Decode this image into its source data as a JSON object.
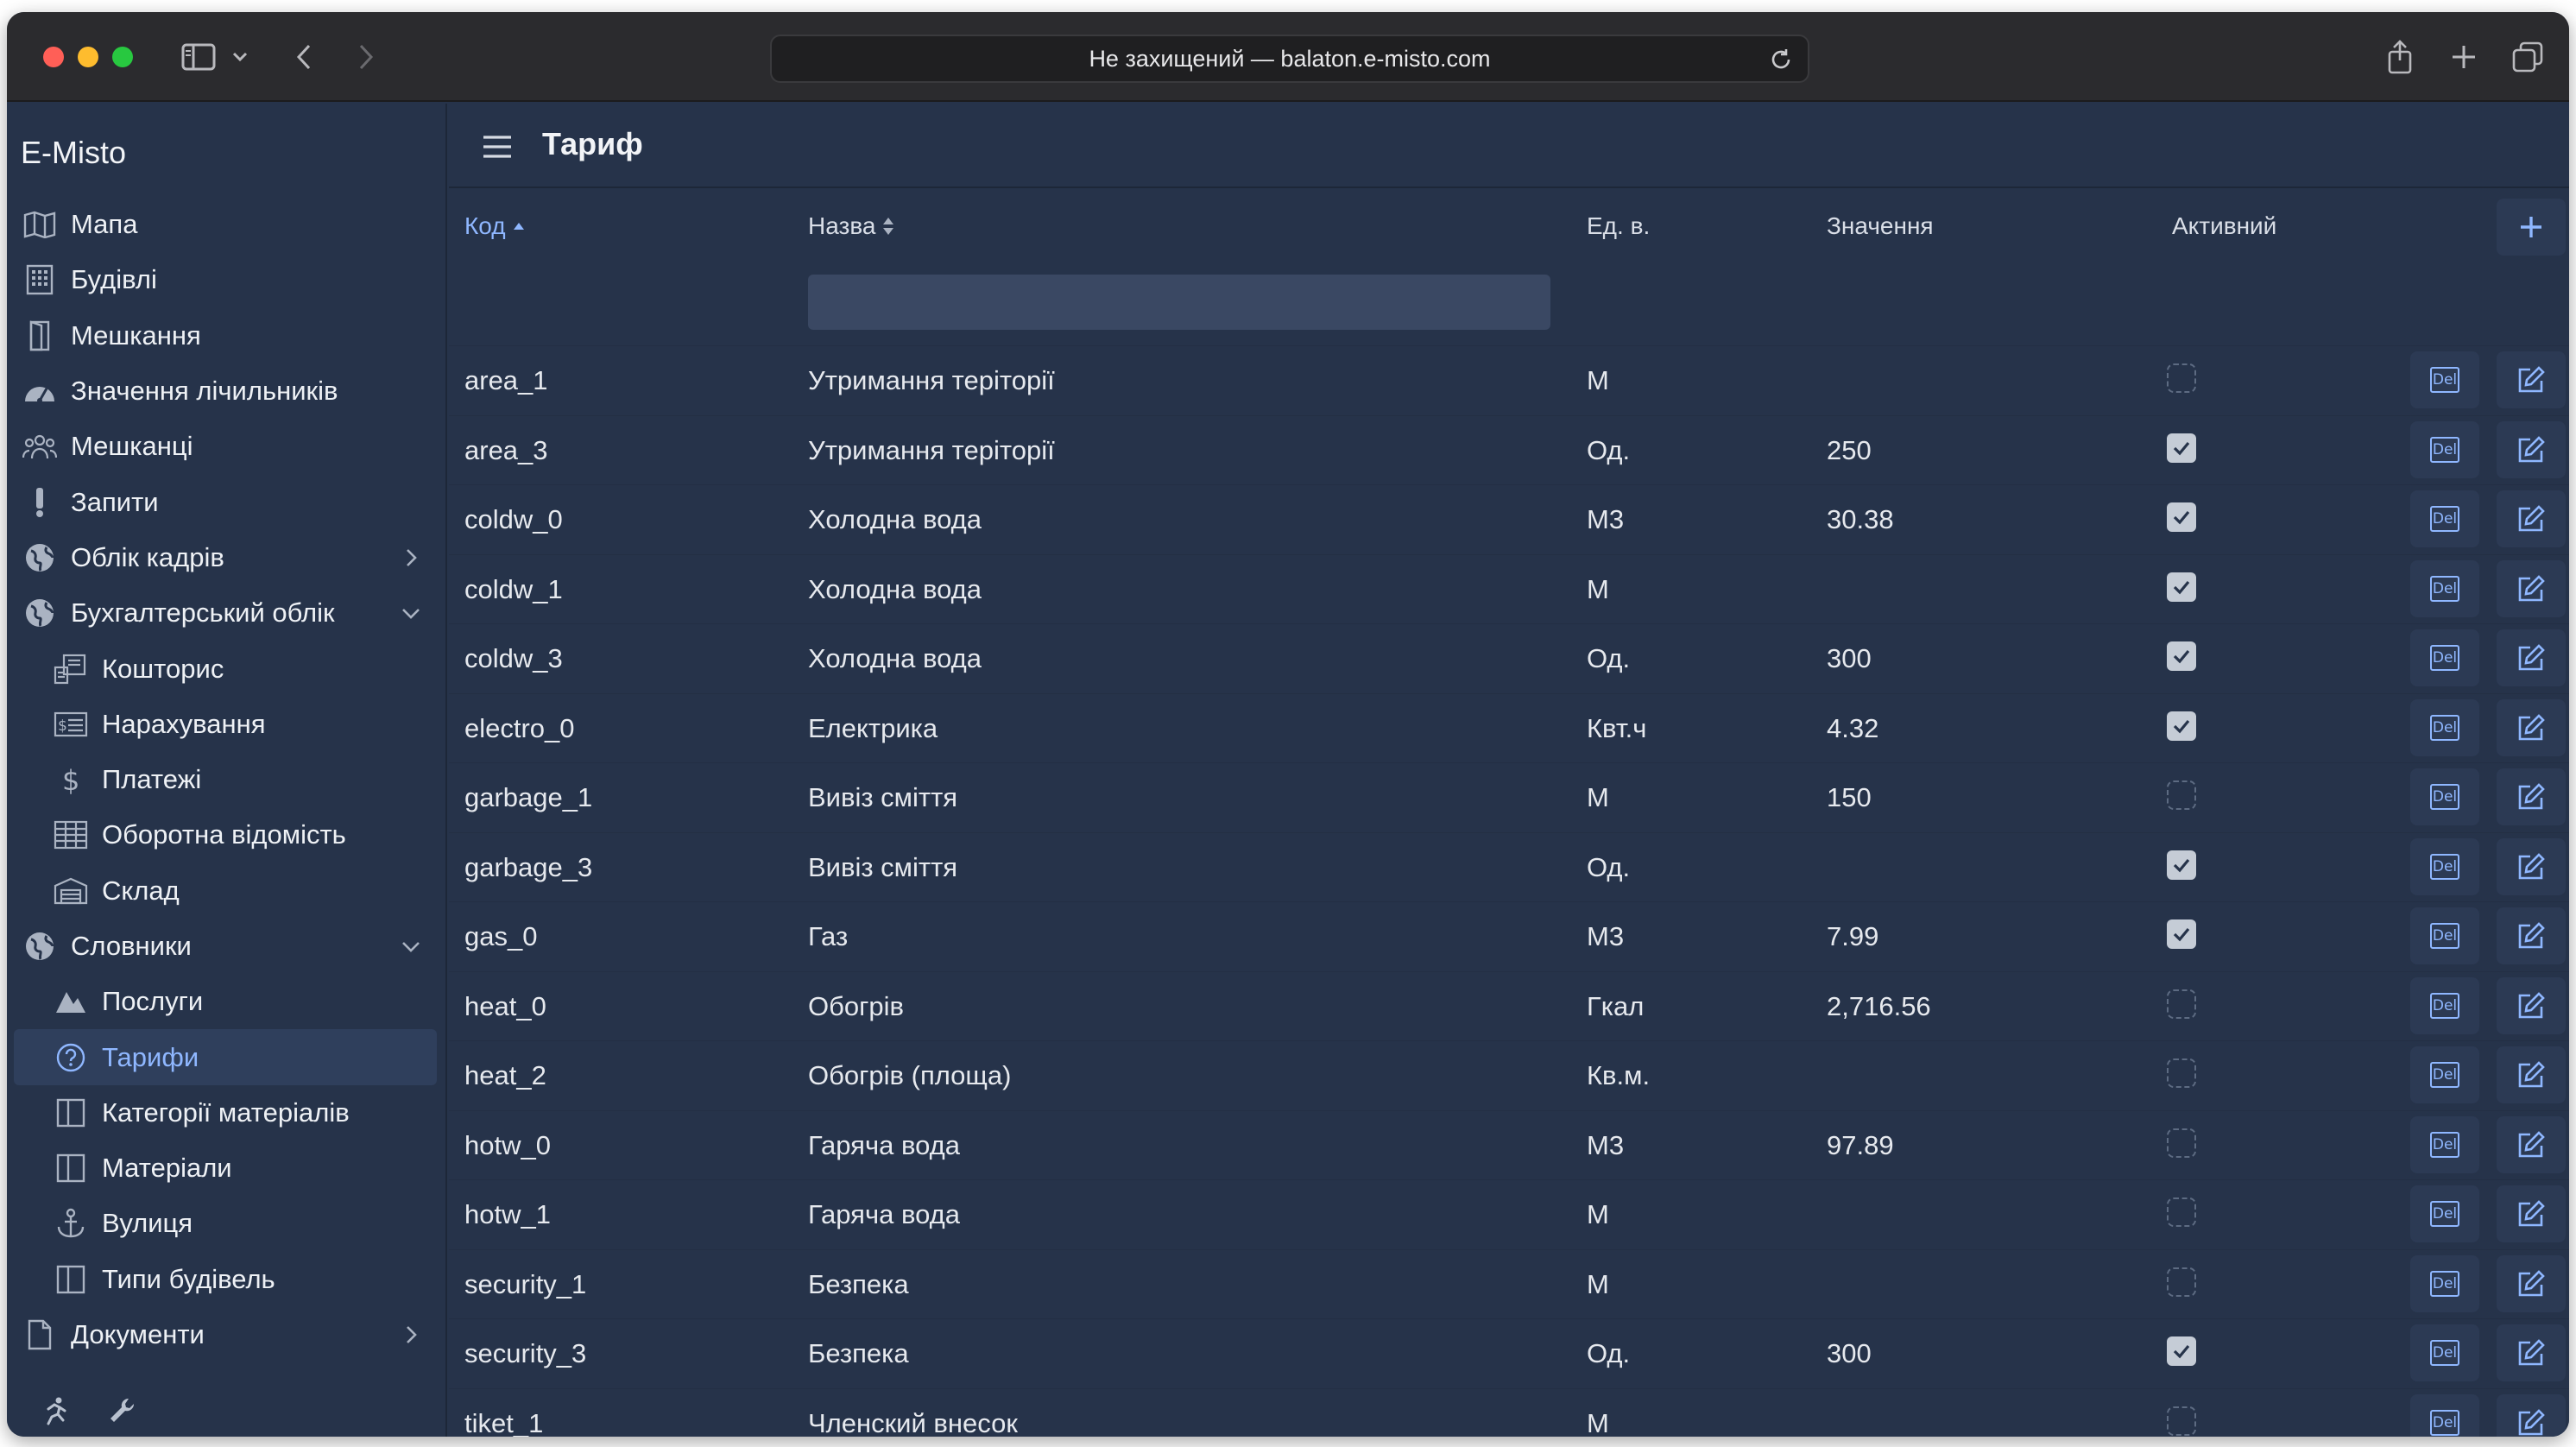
{
  "browser": {
    "url": "Не захищений — balaton.e-misto.com"
  },
  "sidebar": {
    "brand": "E-Misto",
    "items": [
      {
        "label": "Мапа",
        "icon": "map-icon",
        "level": 0
      },
      {
        "label": "Будівлі",
        "icon": "building-icon",
        "level": 0
      },
      {
        "label": "Мешкання",
        "icon": "door-icon",
        "level": 0
      },
      {
        "label": "Значення лічильників",
        "icon": "gauge-icon",
        "level": 0
      },
      {
        "label": "Мешканці",
        "icon": "people-icon",
        "level": 0
      },
      {
        "label": "Запити",
        "icon": "exclamation-icon",
        "level": 0
      },
      {
        "label": "Облік кадрів",
        "icon": "globe-icon",
        "level": 0,
        "chevron": "right"
      },
      {
        "label": "Бухгалтерський облік",
        "icon": "globe-icon",
        "level": 0,
        "chevron": "down"
      },
      {
        "label": "Кошторис",
        "icon": "budget-icon",
        "level": 1
      },
      {
        "label": "Нарахування",
        "icon": "invoice-icon",
        "level": 1
      },
      {
        "label": "Платежі",
        "icon": "dollar-icon",
        "level": 1
      },
      {
        "label": "Оборотна відомість",
        "icon": "table-icon",
        "level": 1
      },
      {
        "label": "Склад",
        "icon": "warehouse-icon",
        "level": 1
      },
      {
        "label": "Словники",
        "icon": "globe-icon",
        "level": 0,
        "chevron": "down"
      },
      {
        "label": "Послуги",
        "icon": "services-icon",
        "level": 1
      },
      {
        "label": "Тарифи",
        "icon": "question-icon",
        "level": 1,
        "active": true
      },
      {
        "label": "Категорії матеріалів",
        "icon": "columns-icon",
        "level": 1
      },
      {
        "label": "Матеріали",
        "icon": "columns-icon",
        "level": 1
      },
      {
        "label": "Вулиця",
        "icon": "anchor-icon",
        "level": 1
      },
      {
        "label": "Типи будівель",
        "icon": "columns-icon",
        "level": 1
      },
      {
        "label": "Документи",
        "icon": "document-icon",
        "level": 0,
        "chevron": "right"
      }
    ]
  },
  "page": {
    "title": "Тариф"
  },
  "table": {
    "headers": {
      "code": "Код",
      "name": "Назва",
      "unit": "Ед. в.",
      "value": "Значення",
      "active": "Активний"
    },
    "filter_placeholder": "",
    "delete_label": "Del",
    "rows": [
      {
        "code": "area_1",
        "name": "Утримання теріторії",
        "unit": "М",
        "value": "",
        "active": false
      },
      {
        "code": "area_3",
        "name": "Утримання теріторії",
        "unit": "Од.",
        "value": "250",
        "active": true
      },
      {
        "code": "coldw_0",
        "name": "Холодна вода",
        "unit": "М3",
        "value": "30.38",
        "active": true
      },
      {
        "code": "coldw_1",
        "name": "Холодна вода",
        "unit": "М",
        "value": "",
        "active": true
      },
      {
        "code": "coldw_3",
        "name": "Холодна вода",
        "unit": "Од.",
        "value": "300",
        "active": true
      },
      {
        "code": "electro_0",
        "name": "Електрика",
        "unit": "Квт.ч",
        "value": "4.32",
        "active": true
      },
      {
        "code": "garbage_1",
        "name": "Вивіз сміття",
        "unit": "М",
        "value": "150",
        "active": false
      },
      {
        "code": "garbage_3",
        "name": "Вивіз сміття",
        "unit": "Од.",
        "value": "",
        "active": true
      },
      {
        "code": "gas_0",
        "name": "Газ",
        "unit": "М3",
        "value": "7.99",
        "active": true
      },
      {
        "code": "heat_0",
        "name": "Обогрів",
        "unit": "Гкал",
        "value": "2,716.56",
        "active": false
      },
      {
        "code": "heat_2",
        "name": "Обогрів (площа)",
        "unit": "Кв.м.",
        "value": "",
        "active": false
      },
      {
        "code": "hotw_0",
        "name": "Гаряча вода",
        "unit": "М3",
        "value": "97.89",
        "active": false
      },
      {
        "code": "hotw_1",
        "name": "Гаряча вода",
        "unit": "М",
        "value": "",
        "active": false
      },
      {
        "code": "security_1",
        "name": "Безпека",
        "unit": "М",
        "value": "",
        "active": false
      },
      {
        "code": "security_3",
        "name": "Безпека",
        "unit": "Од.",
        "value": "300",
        "active": true
      },
      {
        "code": "tiket_1",
        "name": "Членский внесок",
        "unit": "М",
        "value": "",
        "active": false
      }
    ]
  }
}
